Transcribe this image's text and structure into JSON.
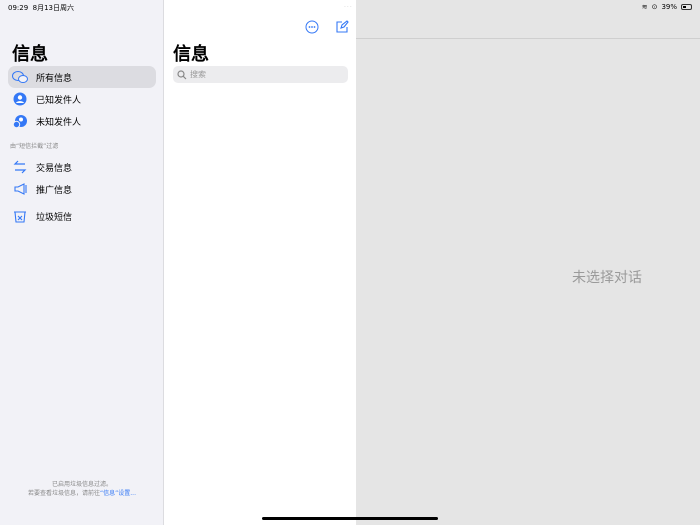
{
  "status": {
    "time": "09:29",
    "date": "8月13日周六",
    "battery": "39%"
  },
  "sidebar": {
    "title": "信息",
    "items": [
      {
        "label": "所有信息"
      },
      {
        "label": "已知发件人"
      },
      {
        "label": "未知发件人"
      }
    ],
    "section": "由“短信拦截”过滤",
    "filter_items": [
      {
        "label": "交易信息"
      },
      {
        "label": "推广信息"
      }
    ],
    "junk": {
      "label": "垃圾短信"
    },
    "footer": {
      "line1": "已启用垃圾信息过滤。",
      "line2_prefix": "若要查看垃圾信息，请前往",
      "link": "“信息”设置..."
    }
  },
  "list": {
    "title": "信息",
    "search_placeholder": "搜索"
  },
  "detail": {
    "empty_text": "未选择对话"
  },
  "colors": {
    "accent": "#3478f6"
  }
}
